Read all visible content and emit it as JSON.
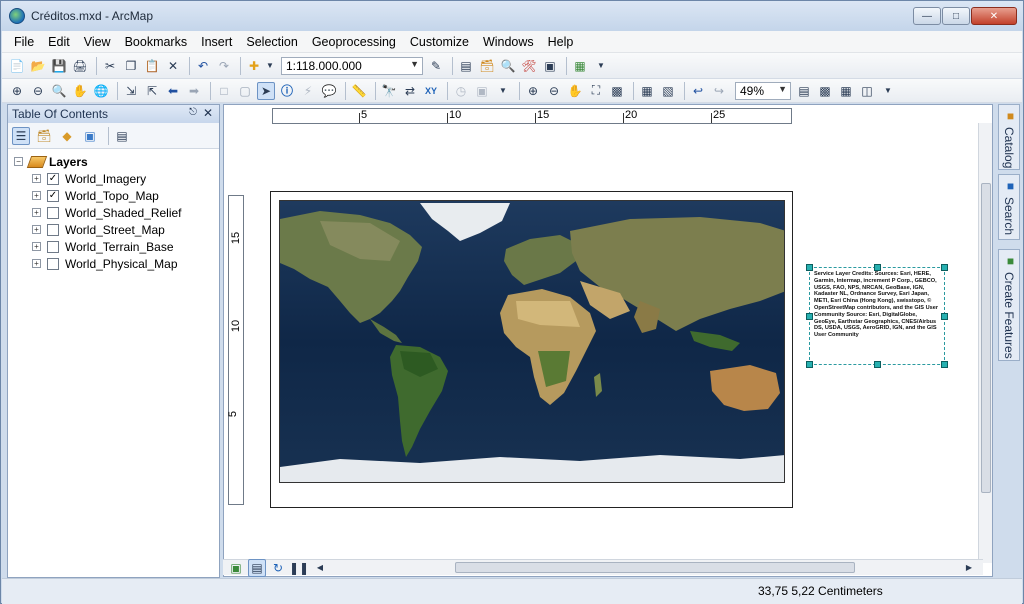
{
  "window": {
    "title": "Créditos.mxd - ArcMap",
    "minimize_icon": "minimize-icon",
    "maximize_icon": "maximize-icon",
    "close_icon": "close-icon"
  },
  "menu": {
    "items": [
      "File",
      "Edit",
      "View",
      "Bookmarks",
      "Insert",
      "Selection",
      "Geoprocessing",
      "Customize",
      "Windows",
      "Help"
    ]
  },
  "toolbar": {
    "scale_value": "1:118.000.000",
    "zoom_value": "49%"
  },
  "toc": {
    "title": "Table Of Contents",
    "root_label": "Layers",
    "layers": [
      {
        "name": "World_Imagery",
        "checked": true
      },
      {
        "name": "World_Topo_Map",
        "checked": true
      },
      {
        "name": "World_Shaded_Relief",
        "checked": false
      },
      {
        "name": "World_Street_Map",
        "checked": false
      },
      {
        "name": "World_Terrain_Base",
        "checked": false
      },
      {
        "name": "World_Physical_Map",
        "checked": false
      }
    ]
  },
  "rulers": {
    "horizontal": [
      "5",
      "10",
      "15",
      "20",
      "25"
    ],
    "vertical": [
      "15",
      "10",
      "5"
    ]
  },
  "layout": {
    "credits_text": "Service Layer Credits: Sources: Esri, HERE, Garmin, Intermap, increment P Corp., GEBCO, USGS, FAO, NPS, NRCAN, GeoBase, IGN, Kadaster NL, Ordnance Survey, Esri Japan, METI, Esri China (Hong Kong), swisstopo, © OpenStreetMap contributors, and the GIS User Community Source: Esri, DigitalGlobe, GeoEye, Earthstar Geographics, CNES/Airbus DS, USDA, USGS, AeroGRID, IGN, and the GIS User Community"
  },
  "side_tabs": [
    "Catalog",
    "Search",
    "Create Features"
  ],
  "status": {
    "coordinates": "33,75  5,22 Centimeters"
  }
}
